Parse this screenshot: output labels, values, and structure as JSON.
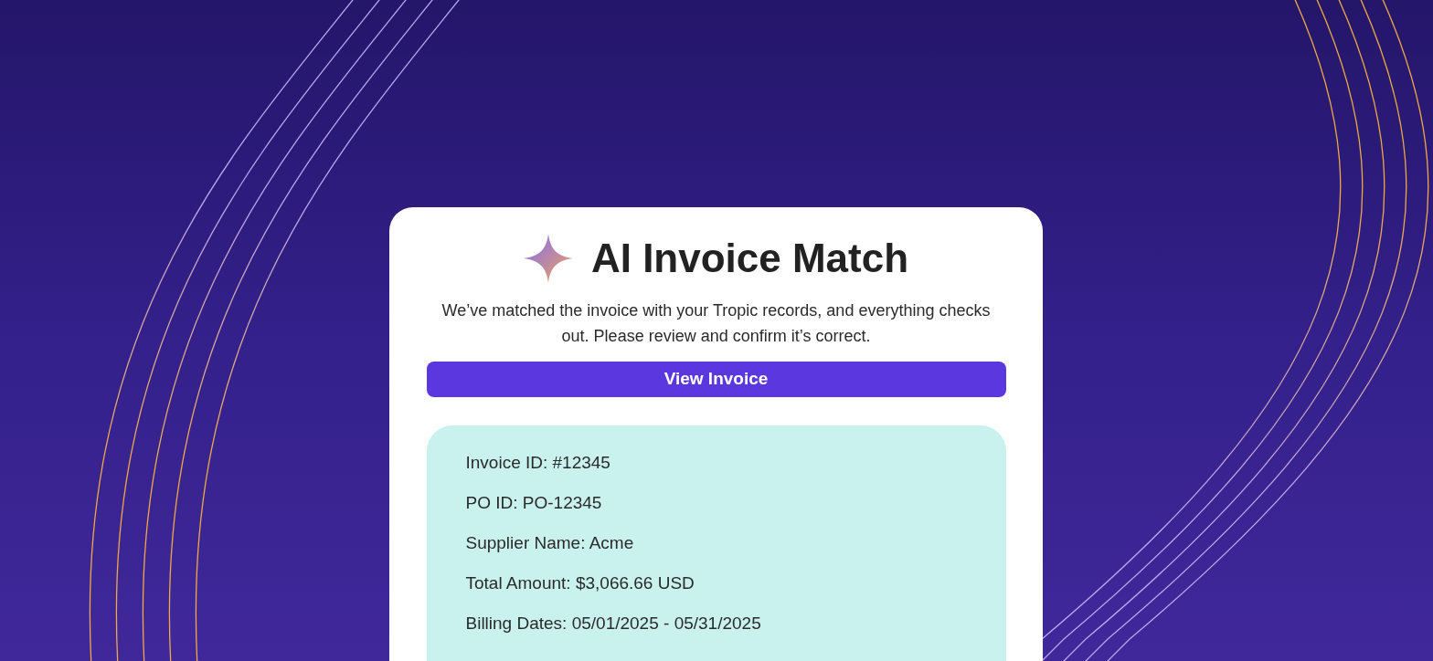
{
  "card": {
    "title": "AI Invoice Match",
    "description": "We’ve matched the invoice with your Tropic records, and everything checks out. Please review and confirm it’s correct.",
    "button": "View Invoice",
    "details": [
      "Invoice ID: #12345",
      "PO ID: PO-12345",
      "Supplier Name: Acme",
      "Total Amount: $3,066.66 USD",
      "Billing Dates: 05/01/2025 - 05/31/2025"
    ]
  }
}
